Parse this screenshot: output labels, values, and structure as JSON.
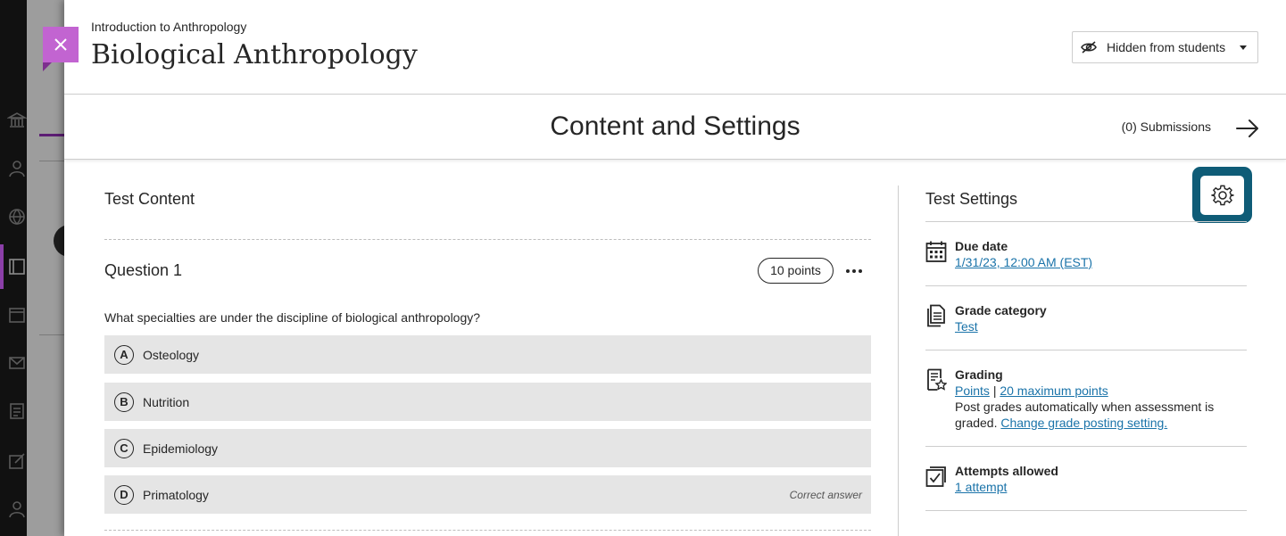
{
  "header": {
    "breadcrumb": "Introduction to Anthropology",
    "title": "Biological Anthropology",
    "visibility_label": "Hidden from students"
  },
  "subheader": {
    "section_title": "Content and Settings",
    "submissions_label": "(0) Submissions"
  },
  "content": {
    "label": "Test Content",
    "question": {
      "title": "Question 1",
      "points": "10 points",
      "text": "What specialties are under the discipline of biological anthropology?",
      "answers": [
        {
          "letter": "A",
          "text": "Osteology"
        },
        {
          "letter": "B",
          "text": "Nutrition"
        },
        {
          "letter": "C",
          "text": "Epidemiology"
        },
        {
          "letter": "D",
          "text": "Primatology",
          "note": "Correct answer"
        }
      ]
    }
  },
  "settings": {
    "label": "Test Settings",
    "due_date": {
      "title": "Due date",
      "value": "1/31/23, 12:00 AM (EST)"
    },
    "grade_category": {
      "title": "Grade category",
      "value": "Test"
    },
    "grading": {
      "title": "Grading",
      "schema": "Points",
      "separator": "|",
      "max_points": "20 maximum points",
      "description": "Post grades automatically when assessment is graded.",
      "change_link": "Change grade posting setting."
    },
    "attempts": {
      "title": "Attempts allowed",
      "value": "1 attempt"
    }
  },
  "colors": {
    "accent": "#c264d1",
    "focus_ring": "#0f5c77",
    "link": "#1a73a9"
  }
}
